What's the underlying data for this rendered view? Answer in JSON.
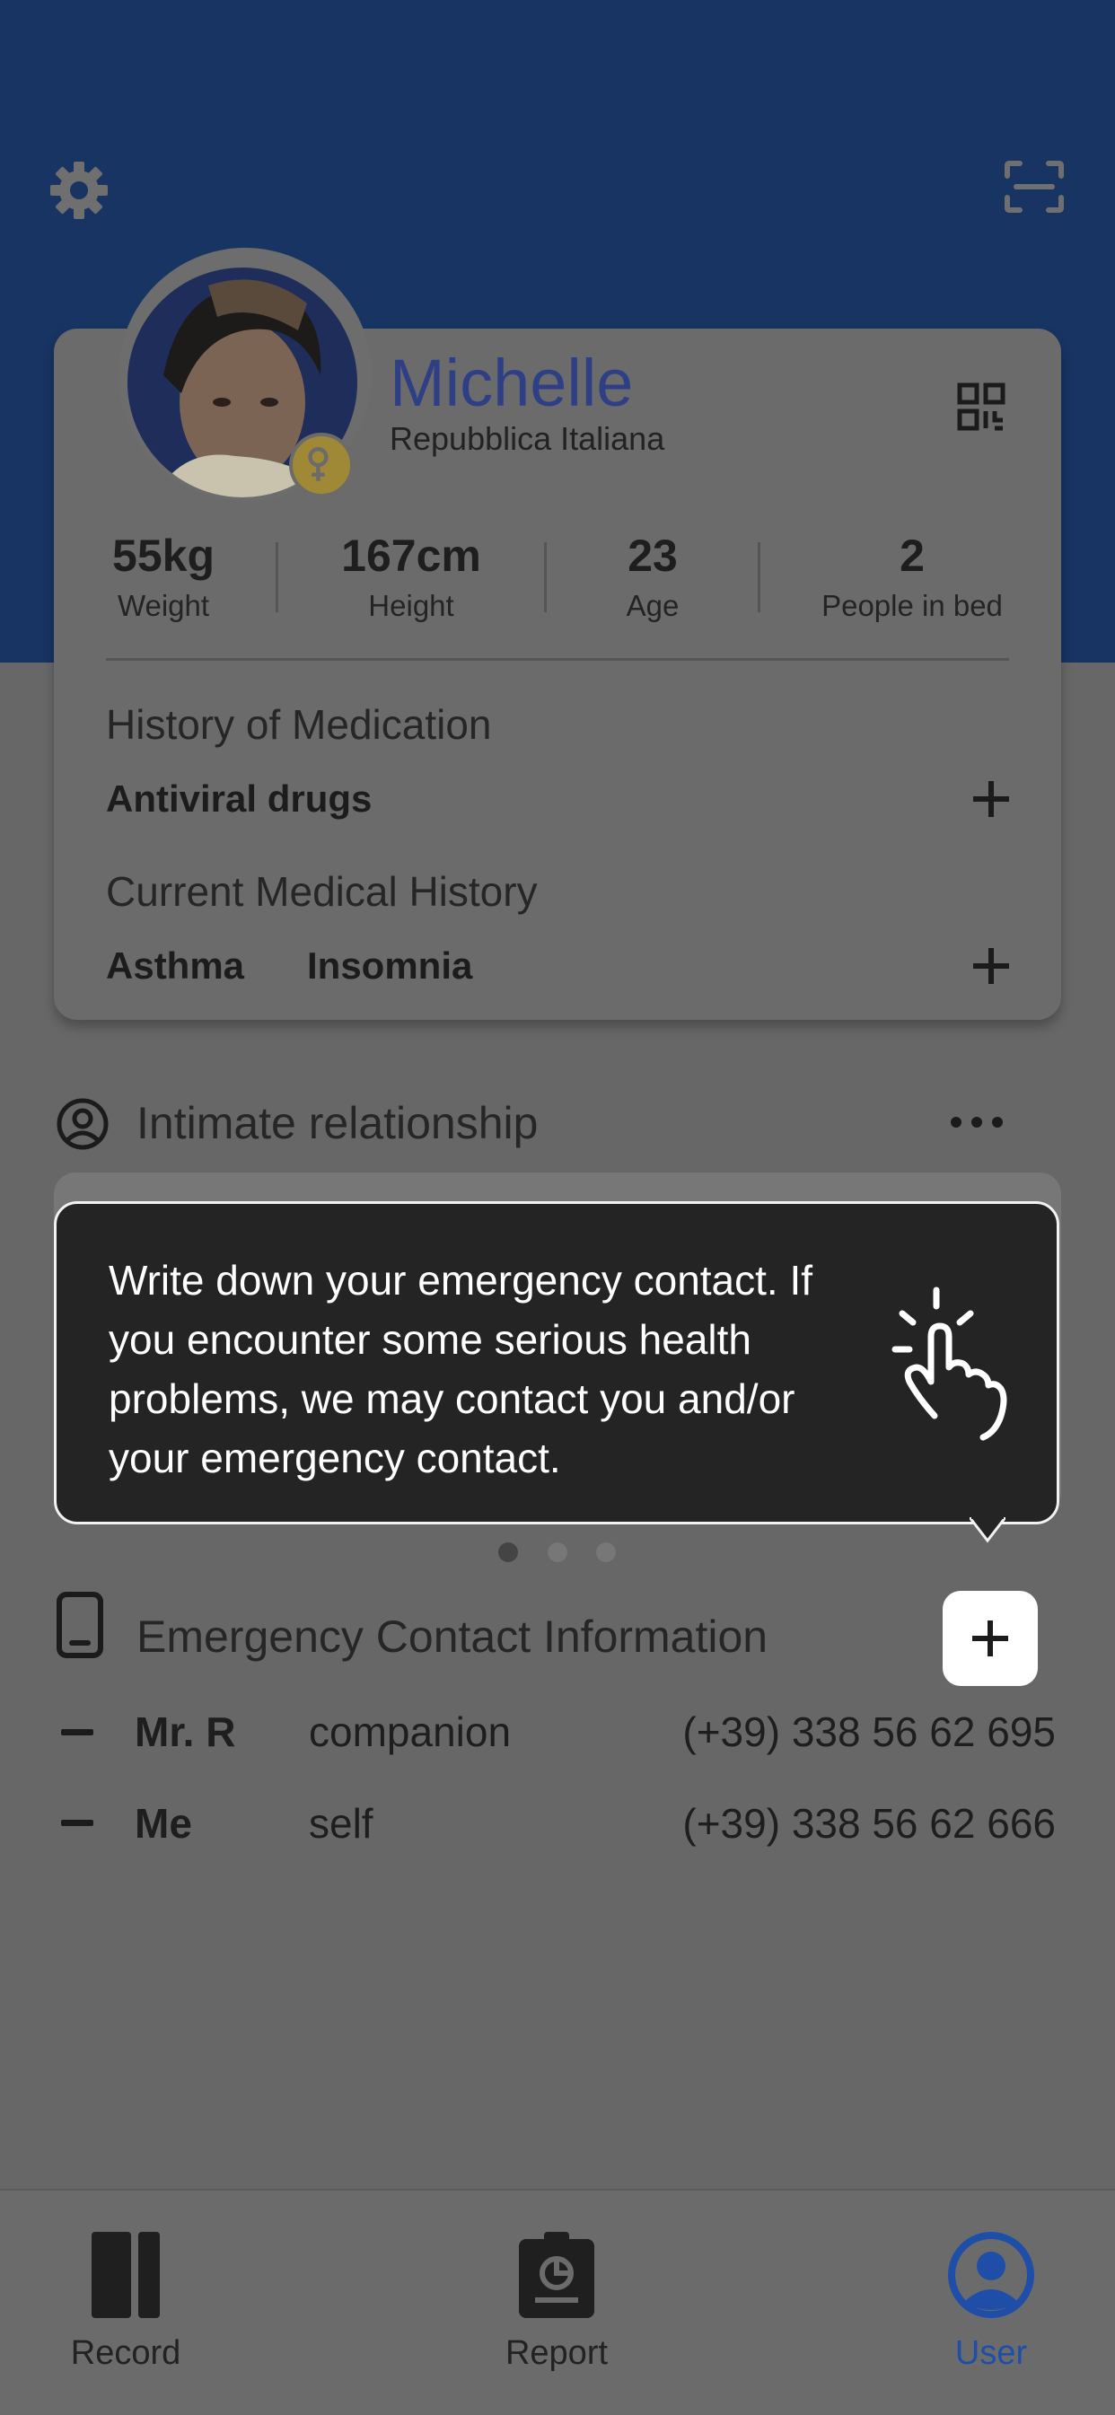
{
  "profile": {
    "name": "Michelle",
    "country": "Repubblica Italiana",
    "stats": [
      {
        "value": "55kg",
        "label": "Weight"
      },
      {
        "value": "167cm",
        "label": "Height"
      },
      {
        "value": "23",
        "label": "Age"
      },
      {
        "value": "2",
        "label": "People in bed"
      }
    ],
    "medication": {
      "title": "History of Medication",
      "items": [
        "Antiviral drugs"
      ]
    },
    "medical_history": {
      "title": "Current Medical History",
      "items": [
        "Asthma",
        "Insomnia"
      ]
    }
  },
  "intimate": {
    "label": "Intimate relationship"
  },
  "popup": {
    "text": "Write down your emergency contact. If you encounter some serious health problems, we may contact you and/or your emergency contact."
  },
  "emergency": {
    "label": "Emergency Contact Information",
    "contacts": [
      {
        "name": "Mr. R",
        "relation": "companion",
        "phone": "(+39) 338 56 62 695"
      },
      {
        "name": "Me",
        "relation": "self",
        "phone": "(+39) 338 56 62 666"
      }
    ]
  },
  "nav": {
    "items": [
      {
        "label": "Record",
        "icon": "book-icon"
      },
      {
        "label": "Report",
        "icon": "clipboard-chart-icon"
      },
      {
        "label": "User",
        "icon": "user-icon"
      }
    ],
    "active": "User"
  },
  "colors": {
    "header": "#173462",
    "accent": "#2e3f86",
    "active_nav": "#1e4ea8",
    "badge": "#a08936"
  }
}
